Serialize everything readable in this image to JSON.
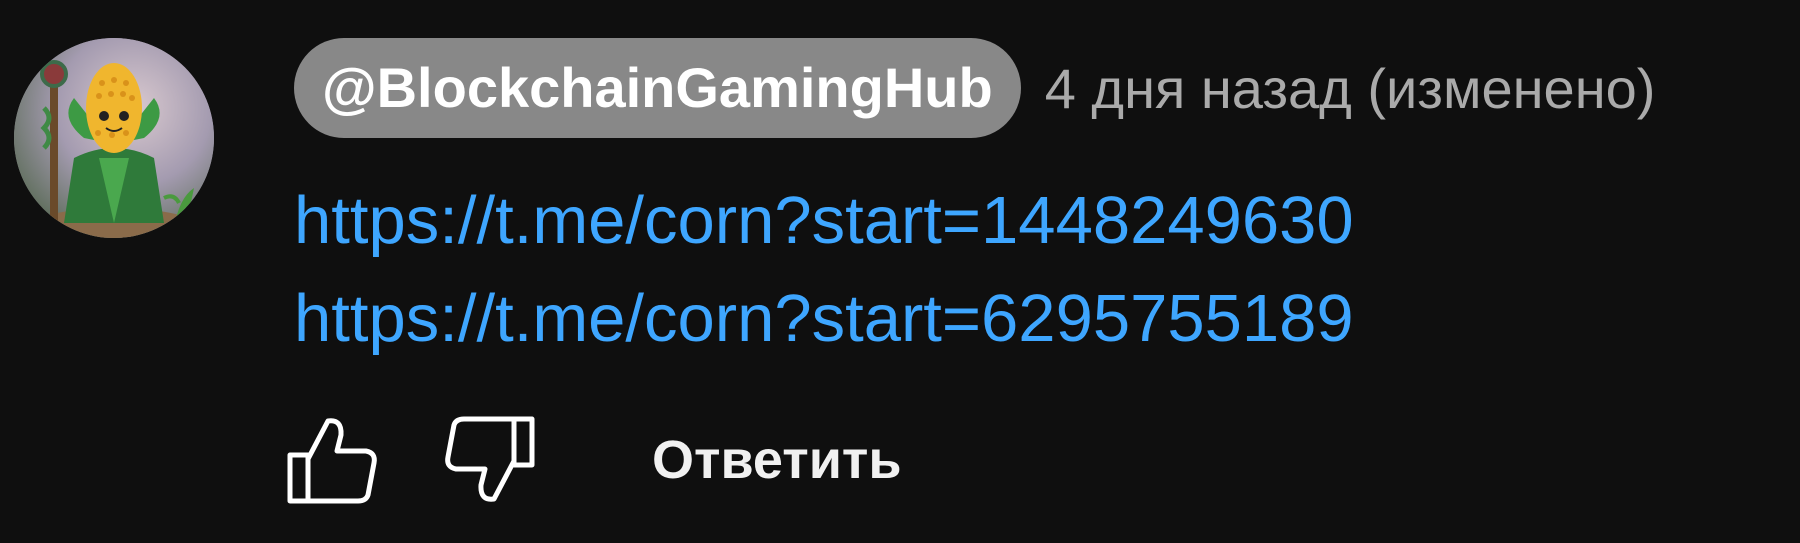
{
  "comment": {
    "author": "@BlockchainGamingHub",
    "timestamp": "4 дня назад (изменено)",
    "links": [
      "https://t.me/corn?start=1448249630",
      "https://t.me/corn?start=6295755189"
    ]
  },
  "actions": {
    "like_icon": "thumbs-up-icon",
    "dislike_icon": "thumbs-down-icon",
    "reply_label": "Ответить"
  },
  "colors": {
    "background": "#0f0f0f",
    "author_chip": "#888888",
    "link": "#3ea6ff",
    "timestamp": "#aaaaaa"
  }
}
